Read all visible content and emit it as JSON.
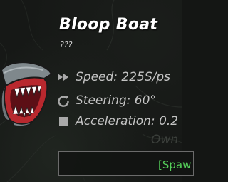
{
  "boat": {
    "name": "Bloop Boat",
    "subtitle": "???",
    "icon": "bloop-boat-icon"
  },
  "stats": {
    "speed": {
      "icon": "fast-forward-icon",
      "label": "Speed: 225S/ps"
    },
    "steering": {
      "icon": "rotate-icon",
      "label": "Steering: 60°"
    },
    "acceleration": {
      "icon": "square-icon",
      "label": "Acceleration: 0.2"
    }
  },
  "background_text": "Own",
  "spawn_button": {
    "label": "[Spaw"
  },
  "colors": {
    "title": "#ffffff",
    "stat_text": "#c4c4c4",
    "spawn_text": "#55d05a",
    "mouth": "#b8282e",
    "teeth": "#ffffff"
  }
}
